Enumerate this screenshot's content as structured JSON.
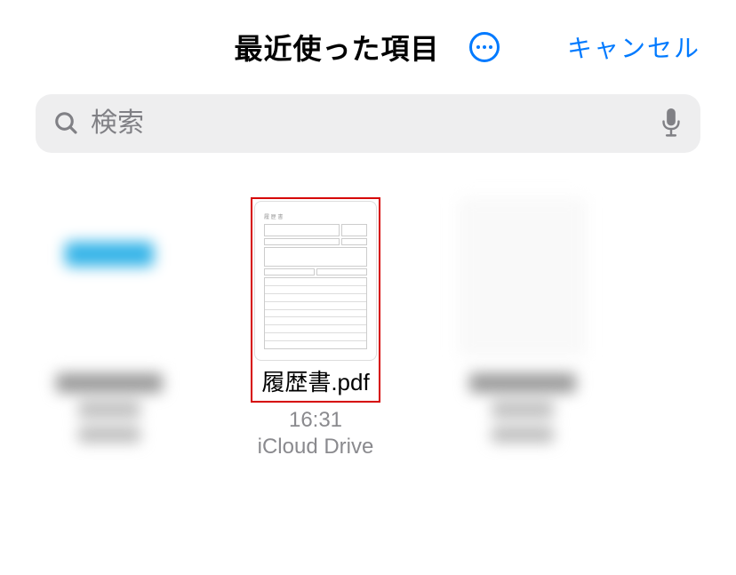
{
  "header": {
    "title": "最近使った項目",
    "cancel": "キャンセル"
  },
  "search": {
    "placeholder": "検索"
  },
  "files": {
    "selected": {
      "name": "履歴書.pdf",
      "time": "16:31",
      "location": "iCloud Drive"
    }
  }
}
